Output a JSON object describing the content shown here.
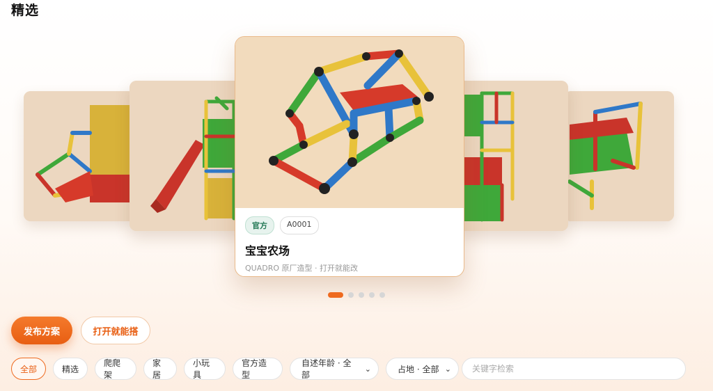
{
  "section": {
    "title": "精选"
  },
  "carousel": {
    "active_index": 0,
    "total": 5,
    "center": {
      "badge": "官方",
      "code": "A0001",
      "title": "宝宝农场",
      "subtitle": "QUADRO 原厂造型 · 打开就能改"
    }
  },
  "actions": {
    "publish": "发布方案",
    "open_build": "打开就能搭"
  },
  "filters": {
    "pills": [
      "全部",
      "精选",
      "爬爬架",
      "家居",
      "小玩具",
      "官方造型"
    ],
    "active": "全部",
    "age_select": {
      "label": "自述年龄 · 全部"
    },
    "area_select": {
      "label": "占地 · 全部"
    }
  },
  "search": {
    "placeholder": "关键字检索",
    "value": ""
  },
  "colors": {
    "accent": "#EE6A1F",
    "card_bg": "#F2DBBD",
    "red": "#D63A2A",
    "yellow": "#E8C23A",
    "green": "#3FA83A",
    "blue": "#2F78C8"
  }
}
